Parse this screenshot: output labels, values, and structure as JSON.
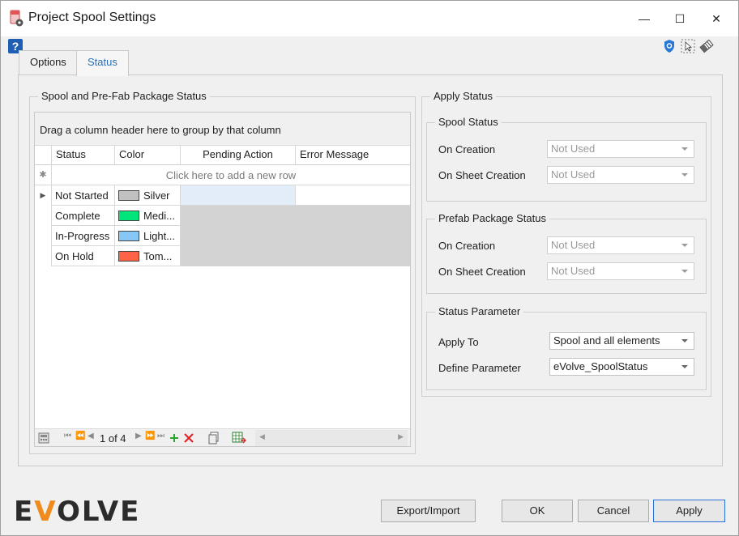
{
  "window": {
    "title": "Project Spool Settings",
    "min_glyph": "—",
    "max_glyph": "☐",
    "close_glyph": "✕"
  },
  "help_glyph": "?",
  "tabs": [
    {
      "label": "Options",
      "selected": false
    },
    {
      "label": "Status",
      "selected": true
    }
  ],
  "left_group": {
    "title": "Spool and Pre-Fab Package Status",
    "group_hint": "Drag a column header here to group by that column",
    "columns": [
      "Status",
      "Color",
      "Pending Action",
      "Error Message"
    ],
    "new_row_text": "Click here to add a new row",
    "new_row_glyph": "✱",
    "current_row_glyph": "▶",
    "rows": [
      {
        "status": "Not Started",
        "color_name": "Silver",
        "color": "#c0c0c0"
      },
      {
        "status": "Complete",
        "color_name": "Medi...",
        "color": "#00e57a"
      },
      {
        "status": "In-Progress",
        "color_name": "Light...",
        "color": "#87c7f5"
      },
      {
        "status": "On Hold",
        "color_name": "Tom...",
        "color": "#ff6347"
      }
    ],
    "pager": {
      "text": "1 of 4"
    }
  },
  "apply_status": {
    "title": "Apply Status",
    "spool_status": {
      "title": "Spool Status",
      "on_creation_label": "On Creation",
      "on_creation_value": "Not Used",
      "on_sheet_label": "On Sheet Creation",
      "on_sheet_value": "Not Used"
    },
    "prefab_status": {
      "title": "Prefab Package Status",
      "on_creation_label": "On Creation",
      "on_creation_value": "Not Used",
      "on_sheet_label": "On Sheet Creation",
      "on_sheet_value": "Not Used"
    },
    "status_parameter": {
      "title": "Status Parameter",
      "apply_to_label": "Apply To",
      "apply_to_value": "Spool and all elements",
      "define_label": "Define Parameter",
      "define_value": "eVolve_SpoolStatus"
    }
  },
  "logo": {
    "e": "E",
    "v": "V",
    "rest": "OLVE"
  },
  "buttons": {
    "export": "Export/Import",
    "ok": "OK",
    "cancel": "Cancel",
    "apply": "Apply"
  },
  "colors": {
    "accent": "#2a6fd6",
    "logo_accent": "#f08a1c"
  }
}
